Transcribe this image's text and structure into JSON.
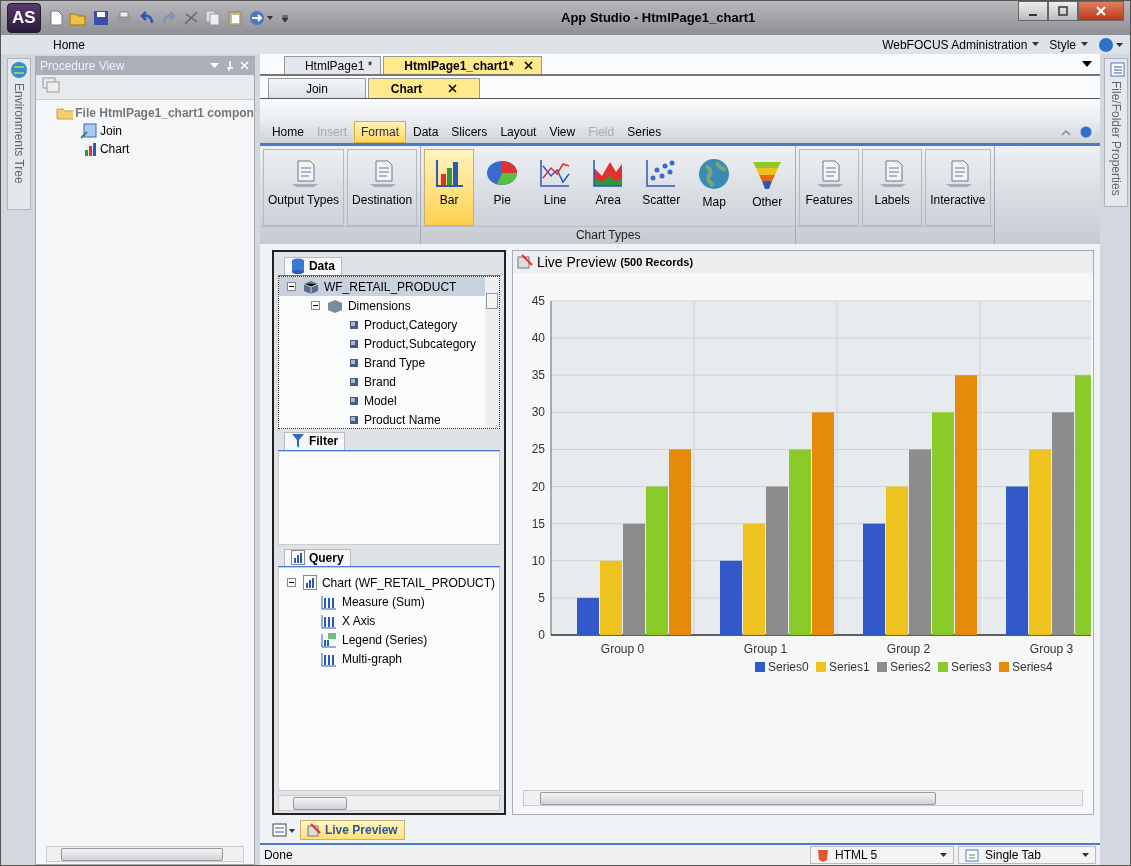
{
  "title_bar": {
    "app_logo": "AS",
    "title": "App Studio - HtmlPage1_chart1"
  },
  "menu": {
    "home": "Home",
    "admin": "WebFOCUS Administration",
    "style": "Style"
  },
  "left_strip": {
    "label": "Environments Tree"
  },
  "procedure_view": {
    "title": "Procedure View",
    "tree": [
      {
        "label": "File HtmlPage1_chart1 compon",
        "kind": "folder",
        "children": [
          {
            "label": "Join",
            "kind": "join"
          },
          {
            "label": "Chart",
            "kind": "chart"
          }
        ]
      }
    ]
  },
  "document_tabs": [
    {
      "label": "HtmlPage1 *",
      "selected": false
    },
    {
      "label": "HtmlPage1_chart1*",
      "selected": true
    }
  ],
  "sub_tabs": [
    {
      "label": "Join",
      "selected": false
    },
    {
      "label": "Chart",
      "selected": true
    }
  ],
  "ribbon_tabs": [
    {
      "label": "Home",
      "selected": false,
      "disabled": false
    },
    {
      "label": "Insert",
      "selected": false,
      "disabled": true
    },
    {
      "label": "Format",
      "selected": true,
      "disabled": false
    },
    {
      "label": "Data",
      "selected": false,
      "disabled": false
    },
    {
      "label": "Slicers",
      "selected": false,
      "disabled": false
    },
    {
      "label": "Layout",
      "selected": false,
      "disabled": false
    },
    {
      "label": "View",
      "selected": false,
      "disabled": false
    },
    {
      "label": "Field",
      "selected": false,
      "disabled": true
    },
    {
      "label": "Series",
      "selected": false,
      "disabled": false
    }
  ],
  "ribbon_groups": [
    {
      "buttons": [
        {
          "label": "Output Types",
          "kind": "doc",
          "selected": false
        },
        {
          "label": "Destination",
          "kind": "doc",
          "selected": false
        }
      ]
    },
    {
      "label": "Chart Types",
      "buttons": [
        {
          "label": "Bar",
          "kind": "bar",
          "selected": true
        },
        {
          "label": "Pie",
          "kind": "pie",
          "selected": false
        },
        {
          "label": "Line",
          "kind": "line",
          "selected": false
        },
        {
          "label": "Area",
          "kind": "area",
          "selected": false
        },
        {
          "label": "Scatter",
          "kind": "scatter",
          "selected": false
        },
        {
          "label": "Map",
          "kind": "globe",
          "selected": false
        },
        {
          "label": "Other",
          "kind": "funnel",
          "selected": false
        }
      ]
    },
    {
      "buttons": [
        {
          "label": "Features",
          "kind": "doc",
          "selected": false
        },
        {
          "label": "Labels",
          "kind": "doc",
          "selected": false
        },
        {
          "label": "Interactive",
          "kind": "doc",
          "selected": false
        }
      ]
    }
  ],
  "data_panel": {
    "title": "Data",
    "tree": [
      {
        "label": "WF_RETAIL_PRODUCT",
        "kind": "cube",
        "expanded": true,
        "selected": true,
        "children": [
          {
            "label": "Dimensions",
            "kind": "dims",
            "expanded": true,
            "selected": false,
            "children": [
              {
                "label": "Product,Category",
                "kind": "field",
                "selected": false
              },
              {
                "label": "Product,Subcategory",
                "kind": "field",
                "selected": false
              },
              {
                "label": "Brand Type",
                "kind": "field",
                "selected": false
              },
              {
                "label": "Brand",
                "kind": "field",
                "selected": false
              },
              {
                "label": "Model",
                "kind": "field",
                "selected": false
              },
              {
                "label": "Product Name",
                "kind": "field",
                "selected": false
              }
            ]
          }
        ]
      }
    ]
  },
  "filter_panel": {
    "title": "Filter"
  },
  "query_panel": {
    "title": "Query",
    "tree": [
      {
        "label": "Chart (WF_RETAIL_PRODUCT)",
        "kind": "chart",
        "expanded": true,
        "selected": false,
        "children": [
          {
            "label": "Measure (Sum)",
            "kind": "bars",
            "selected": false
          },
          {
            "label": "X Axis",
            "kind": "bars",
            "selected": false
          },
          {
            "label": "Legend (Series)",
            "kind": "legend",
            "selected": false
          },
          {
            "label": "Multi-graph",
            "kind": "bars",
            "selected": false
          }
        ]
      }
    ]
  },
  "preview": {
    "title": "Live Preview",
    "records": "(500 Records)",
    "chart_data": {
      "type": "bar",
      "categories": [
        "Group 0",
        "Group 1",
        "Group 2",
        "Group 3"
      ],
      "series": [
        {
          "name": "Series0",
          "color": "#3358c9",
          "values": [
            5,
            10,
            15,
            20
          ]
        },
        {
          "name": "Series1",
          "color": "#eec21f",
          "values": [
            10,
            15,
            20,
            25
          ]
        },
        {
          "name": "Series2",
          "color": "#8c8c8c",
          "values": [
            15,
            20,
            25,
            30
          ]
        },
        {
          "name": "Series3",
          "color": "#8acb2a",
          "values": [
            20,
            25,
            30,
            35
          ]
        },
        {
          "name": "Series4",
          "color": "#e58a0a",
          "values": [
            25,
            30,
            35,
            null
          ]
        }
      ],
      "grid": true,
      "legend": true,
      "ylim": [
        0,
        45
      ],
      "yticks": [
        0,
        5,
        10,
        15,
        20,
        25,
        30,
        35,
        40,
        45
      ]
    }
  },
  "bottom_tabs": [
    {
      "label": "Live Preview",
      "selected": true
    }
  ],
  "status_bar": {
    "text": "Done",
    "output": "HTML 5",
    "layout": "Single Tab"
  },
  "right_strip": {
    "label": "File/Folder Properties"
  }
}
